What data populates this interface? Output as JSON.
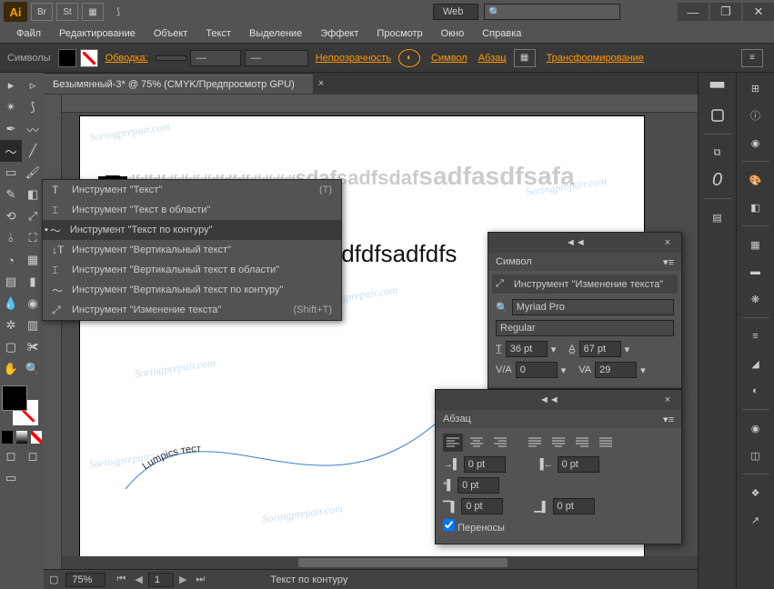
{
  "titlebar": {
    "workspace": "Web",
    "min": "—",
    "max": "❐",
    "close": "✕"
  },
  "menu": [
    "Файл",
    "Редактирование",
    "Объект",
    "Текст",
    "Выделение",
    "Эффект",
    "Просмотр",
    "Окно",
    "Справка"
  ],
  "controlbar": {
    "symbols": "Символы",
    "stroke_label": "Обводка:",
    "opacity_label": "Непрозрачность",
    "char": "Символ",
    "para": "Абзац",
    "transform": "Трансформирование"
  },
  "doc": {
    "tab": "Безымянный-3* @ 75% (CMYK/Предпросмотр GPU)"
  },
  "artboard": {
    "text1a": "dfdfdf",
    "text1b": "dfdfdfdf",
    "text1c": "dfdfdf",
    "text1d": "dfdfdfdf",
    "text1e": "sdafsadfsdaf",
    "text1f": "sadfasdfsafa",
    "text2": "fdfdfsadfdfs",
    "curve_text": "Lumpics тест"
  },
  "ctx": {
    "items": [
      {
        "icon": "T",
        "label": "Инструмент \"Текст\"",
        "sc": "(T)"
      },
      {
        "icon": "⌶",
        "label": "Инструмент \"Текст в области\"",
        "sc": ""
      },
      {
        "icon": "〜",
        "label": "Инструмент \"Текст по контуру\"",
        "sc": ""
      },
      {
        "icon": "↓T",
        "label": "Инструмент \"Вертикальный текст\"",
        "sc": ""
      },
      {
        "icon": "⌶",
        "label": "Инструмент \"Вертикальный текст в области\"",
        "sc": ""
      },
      {
        "icon": "〜",
        "label": "Инструмент \"Вертикальный текст по контуру\"",
        "sc": ""
      },
      {
        "icon": "⤢",
        "label": "Инструмент \"Изменение текста\"",
        "sc": "(Shift+T)"
      }
    ]
  },
  "char_panel": {
    "title": "Символ",
    "tool_link": "Инструмент \"Изменение текста\"",
    "font": "Myriad Pro",
    "style": "Regular",
    "size": "36 pt",
    "leading": "67 pt",
    "kerning": "0",
    "tracking": "29"
  },
  "para_panel": {
    "title": "Абзац",
    "indent_left": "0 pt",
    "indent_right": "0 pt",
    "indent_first": "0 pt",
    "space_before": "0 pt",
    "space_after": "0 pt",
    "hyphenate": "Переносы"
  },
  "status": {
    "zoom": "75%",
    "page": "1",
    "tool": "Текст по контуру"
  },
  "watermark": "Soringprepair.com"
}
